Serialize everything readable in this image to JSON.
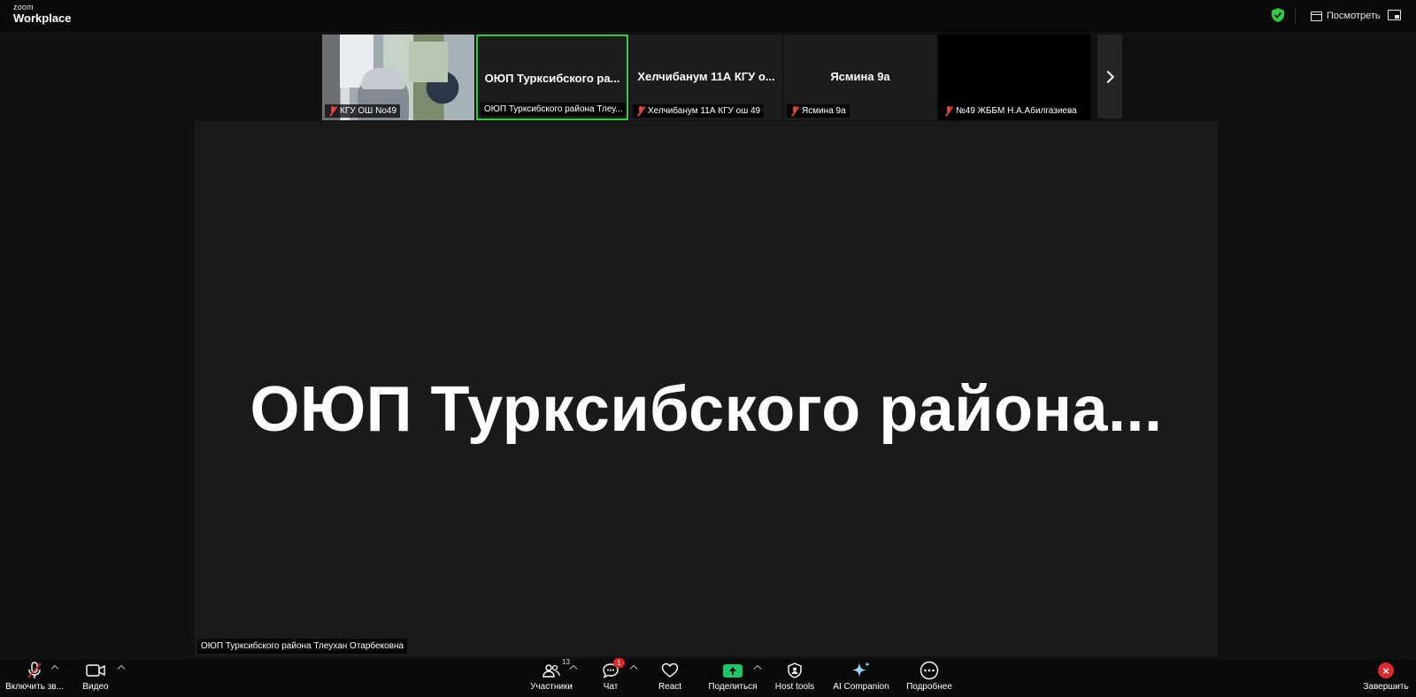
{
  "app": {
    "logo_top": "zoom",
    "logo_bottom": "Workplace",
    "view_label": "Посмотреть",
    "colors": {
      "accent_green": "#2ecc40",
      "danger_red": "#e02828",
      "share_green": "#17c964"
    }
  },
  "thumbnails": [
    {
      "big_name": "",
      "caption": "КГУ ОШ No49",
      "muted": true,
      "camera_on": true,
      "active": false
    },
    {
      "big_name": "ОЮП Туркcибского ра...",
      "caption": "ОЮП Туркcибского района Тлеу...",
      "muted": false,
      "camera_on": false,
      "active": true
    },
    {
      "big_name": "Хелчибанум 11А КГУ о...",
      "caption": "Хелчибанум 11А КГУ ош 49",
      "muted": true,
      "camera_on": false,
      "active": false
    },
    {
      "big_name": "Ясмина 9а",
      "caption": "Ясмина 9а",
      "muted": true,
      "camera_on": false,
      "active": false
    },
    {
      "big_name": "",
      "caption": "№49 ЖББМ Н.А.Абилгазиева",
      "muted": true,
      "camera_on": false,
      "active": false
    }
  ],
  "stage": {
    "big_name": "ОЮП Туркcибского района...",
    "speaker_label": "ОЮП Туркcибского района Тлеухан Отарбековна"
  },
  "toolbar": {
    "audio_label": "Включить зв...",
    "video_label": "Видео",
    "participants_label": "Участники",
    "participants_count": "13",
    "chat_label": "Чат",
    "chat_badge": "1",
    "react_label": "React",
    "share_label": "Поделиться",
    "host_tools_label": "Host tools",
    "ai_label": "AI Companion",
    "more_label": "Подробнее",
    "end_label": "Завершить"
  }
}
